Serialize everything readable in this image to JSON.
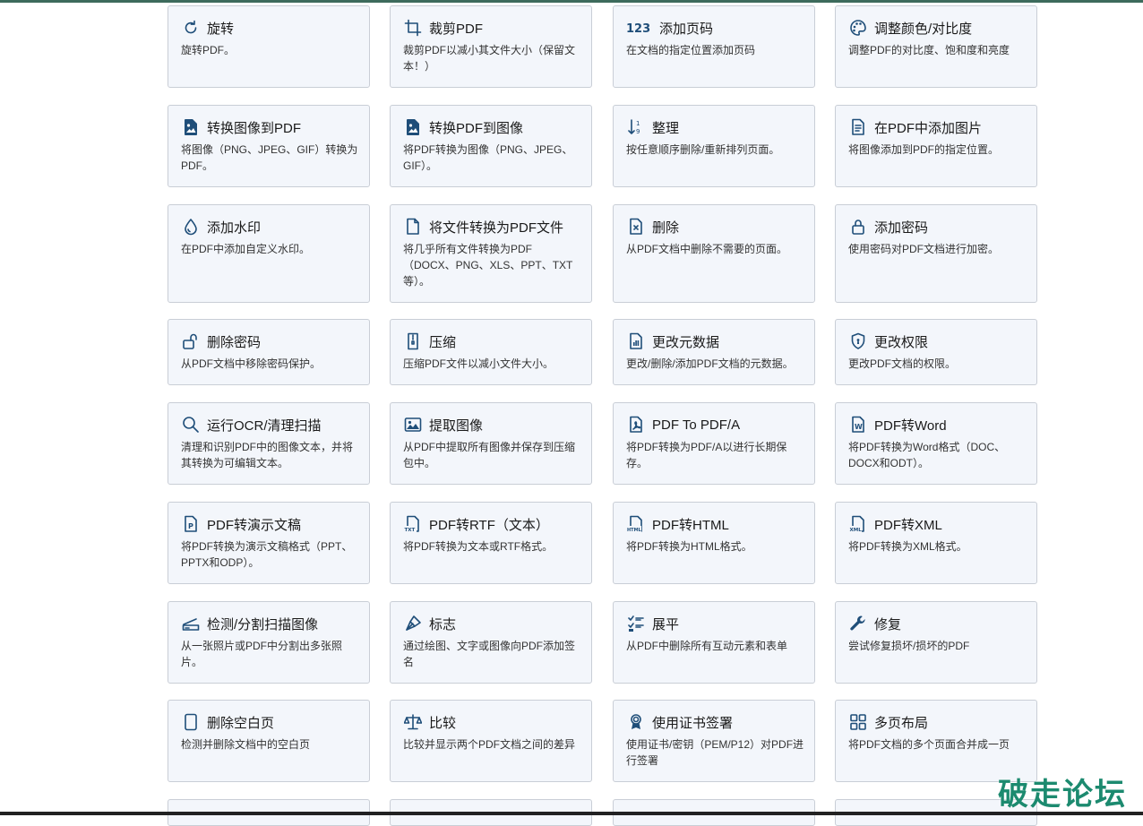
{
  "tools": [
    {
      "title": "旋转",
      "desc": "旋转PDF。",
      "icon": "rotate-icon"
    },
    {
      "title": "裁剪PDF",
      "desc": "裁剪PDF以减小其文件大小（保留文本！）",
      "icon": "crop-icon"
    },
    {
      "title": "添加页码",
      "desc": "在文档的指定位置添加页码",
      "icon": "page-number-icon",
      "icon_text": "123"
    },
    {
      "title": "调整颜色/对比度",
      "desc": "调整PDF的对比度、饱和度和亮度",
      "icon": "palette-icon"
    },
    {
      "title": "转换图像到PDF",
      "desc": "将图像（PNG、JPEG、GIF）转换为PDF。",
      "icon": "image-file-icon"
    },
    {
      "title": "转换PDF到图像",
      "desc": "将PDF转换为图像（PNG、JPEG、GIF）。",
      "icon": "image-file-icon"
    },
    {
      "title": "整理",
      "desc": "按任意顺序删除/重新排列页面。",
      "icon": "sort-icon"
    },
    {
      "title": "在PDF中添加图片",
      "desc": "将图像添加到PDF的指定位置。",
      "icon": "document-text-icon"
    },
    {
      "title": "添加水印",
      "desc": "在PDF中添加自定义水印。",
      "icon": "droplet-icon"
    },
    {
      "title": "将文件转换为PDF文件",
      "desc": "将几乎所有文件转换为PDF（DOCX、PNG、XLS、PPT、TXT等）。",
      "icon": "file-icon"
    },
    {
      "title": "删除",
      "desc": "从PDF文档中删除不需要的页面。",
      "icon": "file-x-icon"
    },
    {
      "title": "添加密码",
      "desc": "使用密码对PDF文档进行加密。",
      "icon": "lock-icon"
    },
    {
      "title": "删除密码",
      "desc": "从PDF文档中移除密码保护。",
      "icon": "unlock-icon"
    },
    {
      "title": "压缩",
      "desc": "压缩PDF文件以减小文件大小。",
      "icon": "zip-icon"
    },
    {
      "title": "更改元数据",
      "desc": "更改/删除/添加PDF文档的元数据。",
      "icon": "bar-chart-icon"
    },
    {
      "title": "更改权限",
      "desc": "更改PDF文档的权限。",
      "icon": "shield-icon"
    },
    {
      "title": "运行OCR/清理扫描",
      "desc": "清理和识别PDF中的图像文本，并将其转换为可编辑文本。",
      "icon": "search-icon"
    },
    {
      "title": "提取图像",
      "desc": "从PDF中提取所有图像并保存到压缩包中。",
      "icon": "images-icon"
    },
    {
      "title": "PDF To PDF/A",
      "desc": "将PDF转换为PDF/A以进行长期保存。",
      "icon": "pdf-file-icon"
    },
    {
      "title": "PDF转Word",
      "desc": "将PDF转换为Word格式（DOC、DOCX和ODT）。",
      "icon": "word-file-icon",
      "icon_text": "W"
    },
    {
      "title": "PDF转演示文稿",
      "desc": "将PDF转换为演示文稿格式（PPT、PPTX和ODP）。",
      "icon": "ppt-file-icon",
      "icon_text": "P"
    },
    {
      "title": "PDF转RTF（文本）",
      "desc": "将PDF转换为文本或RTF格式。",
      "icon": "txt-file-icon",
      "icon_text": "TXT"
    },
    {
      "title": "PDF转HTML",
      "desc": "将PDF转换为HTML格式。",
      "icon": "html-file-icon",
      "icon_text": "HTML"
    },
    {
      "title": "PDF转XML",
      "desc": "将PDF转换为XML格式。",
      "icon": "xml-file-icon",
      "icon_text": "XML"
    },
    {
      "title": "检测/分割扫描图像",
      "desc": "从一张照片或PDF中分割出多张照片。",
      "icon": "scanner-icon"
    },
    {
      "title": "标志",
      "desc": "通过绘图、文字或图像向PDF添加签名",
      "icon": "vector-pen-icon"
    },
    {
      "title": "展平",
      "desc": "从PDF中删除所有互动元素和表单",
      "icon": "ui-checks-icon"
    },
    {
      "title": "修复",
      "desc": "尝试修复损坏/损坏的PDF",
      "icon": "wrench-icon"
    },
    {
      "title": "删除空白页",
      "desc": "检测并删除文档中的空白页",
      "icon": "blank-page-icon"
    },
    {
      "title": "比较",
      "desc": "比较并显示两个PDF文档之间的差异",
      "icon": "scale-icon"
    },
    {
      "title": "使用证书签署",
      "desc": "使用证书/密钥（PEM/P12）对PDF进行签署",
      "icon": "award-icon"
    },
    {
      "title": "多页布局",
      "desc": "将PDF文档的多个页面合并成一页",
      "icon": "grid-icon"
    }
  ],
  "watermark": "破走论坛"
}
